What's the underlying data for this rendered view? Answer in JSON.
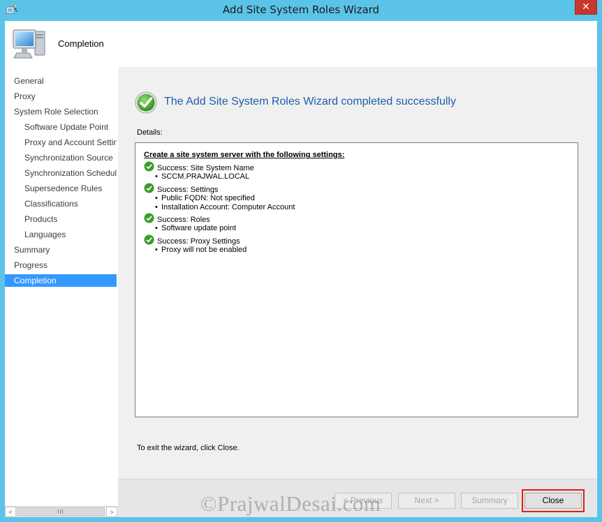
{
  "window": {
    "title": "Add Site System Roles Wizard",
    "close_glyph": "✕"
  },
  "header": {
    "title": "Completion",
    "icon": "computer-icon"
  },
  "nav": {
    "items": [
      {
        "label": "General",
        "level": 0,
        "selected": false
      },
      {
        "label": "Proxy",
        "level": 0,
        "selected": false
      },
      {
        "label": "System Role Selection",
        "level": 0,
        "selected": false
      },
      {
        "label": "Software Update Point",
        "level": 1,
        "selected": false
      },
      {
        "label": "Proxy and Account Settings",
        "level": 1,
        "selected": false
      },
      {
        "label": "Synchronization Source",
        "level": 1,
        "selected": false
      },
      {
        "label": "Synchronization Schedule",
        "level": 1,
        "selected": false
      },
      {
        "label": "Supersedence Rules",
        "level": 1,
        "selected": false
      },
      {
        "label": "Classifications",
        "level": 1,
        "selected": false
      },
      {
        "label": "Products",
        "level": 1,
        "selected": false
      },
      {
        "label": "Languages",
        "level": 1,
        "selected": false
      },
      {
        "label": "Summary",
        "level": 0,
        "selected": false
      },
      {
        "label": "Progress",
        "level": 0,
        "selected": false
      },
      {
        "label": "Completion",
        "level": 0,
        "selected": true
      }
    ],
    "scroll_left": "<",
    "scroll_right": ">",
    "scroll_thumb": "III"
  },
  "main": {
    "success_title": "The Add Site System Roles Wizard completed successfully",
    "details_label": "Details:",
    "exit_text": "To exit the wizard, click Close.",
    "details": {
      "heading": "Create a site system server with the following settings:",
      "entries": [
        {
          "status": "Success: Site System Name",
          "bullets": [
            "SCCM.PRAJWAL.LOCAL"
          ]
        },
        {
          "status": "Success: Settings",
          "bullets": [
            "Public FQDN: Not specified",
            "Installation Account: Computer Account"
          ]
        },
        {
          "status": "Success: Roles",
          "bullets": [
            "Software update point"
          ]
        },
        {
          "status": "Success: Proxy Settings",
          "bullets": [
            "Proxy will not be enabled"
          ]
        }
      ]
    }
  },
  "footer": {
    "previous_label": "< Previous",
    "next_label": "Next >",
    "summary_label": "Summary",
    "close_label": "Close"
  },
  "watermark": "©PrajwalDesai.com",
  "colors": {
    "titlebar": "#5cc3e8",
    "selected_nav": "#3399ff",
    "success_title": "#1e5ea8",
    "close_highlight": "#e31b1b"
  }
}
